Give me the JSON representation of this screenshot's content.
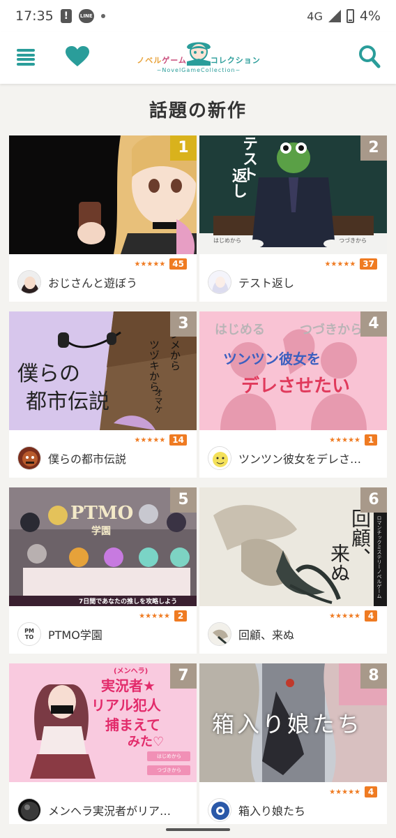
{
  "status_bar": {
    "time": "17:35",
    "notif_icons": [
      "alert-icon",
      "line-icon",
      "dot-icon"
    ],
    "network": "4G",
    "battery": "4%"
  },
  "app_bar": {
    "menu_icon": "hamburger-menu-icon",
    "favorite_icon": "heart-icon",
    "search_icon": "search-icon",
    "logo_title_parts": [
      "ノベル",
      "ゲーム",
      "コレクション"
    ],
    "logo_subtitle": "~NovelGameCollection~"
  },
  "section": {
    "title": "話題の新作"
  },
  "colors": {
    "accent": "#2a9d9a",
    "rating": "#ef7b22",
    "rank_gold": "#d9b21c",
    "rank_grey": "#a8998a"
  },
  "games": [
    {
      "rank": "1",
      "title": "おじさんと遊ぼう",
      "stars": "★★★★★",
      "count": "45",
      "thumb_texts": []
    },
    {
      "rank": "2",
      "title": "テスト返し",
      "stars": "★★★★★",
      "count": "37",
      "thumb_texts": [
        "テスト",
        "返し",
        "はじめから",
        "つづきから"
      ]
    },
    {
      "rank": "3",
      "title": "僕らの都市伝説",
      "stars": "★★★★★",
      "count": "14",
      "thumb_texts": [
        "僕らの",
        "都市伝説",
        "ハジメから",
        "ツヅキから",
        "オマケ"
      ]
    },
    {
      "rank": "4",
      "title": "ツンツン彼女をデレさ…",
      "stars": "★★★★★",
      "count": "1",
      "thumb_texts": [
        "はじめる",
        "つづきから",
        "ツンツン彼女を",
        "デレさせたい"
      ]
    },
    {
      "rank": "5",
      "title": "PTMO学園",
      "stars": "★★★★★",
      "count": "2",
      "thumb_texts": [
        "PTMO",
        "学園",
        "7日間であなたの推しを攻略しよう"
      ]
    },
    {
      "rank": "6",
      "title": "回顧、来ぬ",
      "stars": "★★★★★",
      "count": "4",
      "thumb_texts": [
        "回顧、",
        "来ぬ",
        "ロマンチックミステリーノベルゲーム"
      ]
    },
    {
      "rank": "7",
      "title": "メンヘラ実況者がリア…",
      "stars": "",
      "count": "",
      "thumb_texts": [
        "(メンヘラ)",
        "実況者★",
        "リアル犯人",
        "捕まえて",
        "みた♡",
        "はじめから",
        "つづきから"
      ]
    },
    {
      "rank": "8",
      "title": "箱入り娘たち",
      "stars": "★★★★★",
      "count": "4",
      "thumb_texts": [
        "箱入り娘たち"
      ]
    }
  ],
  "avatar_labels": {
    "pmto": "PM TO"
  }
}
